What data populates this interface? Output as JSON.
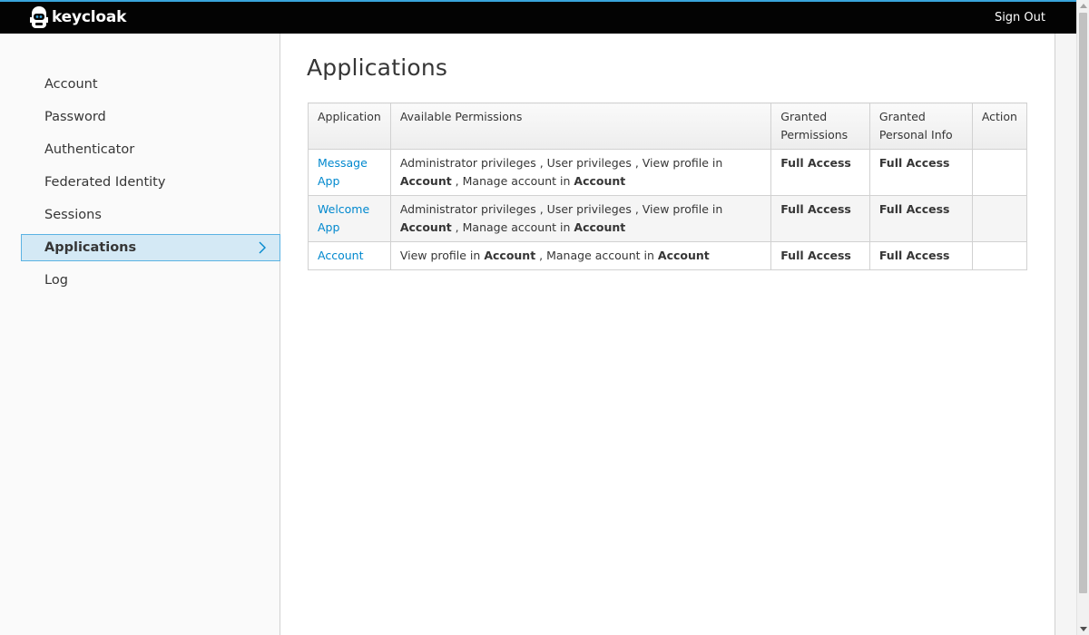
{
  "header": {
    "brand": "keycloak",
    "signout_label": "Sign Out"
  },
  "sidebar": {
    "items": [
      {
        "label": "Account",
        "active": false
      },
      {
        "label": "Password",
        "active": false
      },
      {
        "label": "Authenticator",
        "active": false
      },
      {
        "label": "Federated Identity",
        "active": false
      },
      {
        "label": "Sessions",
        "active": false
      },
      {
        "label": "Applications",
        "active": true
      },
      {
        "label": "Log",
        "active": false
      }
    ]
  },
  "main": {
    "title": "Applications",
    "table": {
      "columns": [
        "Application",
        "Available Permissions",
        "Granted Permissions",
        "Granted Personal Info",
        "Action"
      ],
      "rows": [
        {
          "application": "Message App",
          "permissions": [
            {
              "text": "Administrator privileges",
              "client": ""
            },
            {
              "text": "User privileges",
              "client": ""
            },
            {
              "text": "View profile in",
              "client": "Account"
            },
            {
              "text": "Manage account in",
              "client": "Account"
            }
          ],
          "granted_permissions": "Full Access",
          "granted_personal_info": "Full Access",
          "action": ""
        },
        {
          "application": "Welcome App",
          "permissions": [
            {
              "text": "Administrator privileges",
              "client": ""
            },
            {
              "text": "User privileges",
              "client": ""
            },
            {
              "text": "View profile in",
              "client": "Account"
            },
            {
              "text": "Manage account in",
              "client": "Account"
            }
          ],
          "granted_permissions": "Full Access",
          "granted_personal_info": "Full Access",
          "action": ""
        },
        {
          "application": "Account",
          "permissions": [
            {
              "text": "View profile in",
              "client": "Account"
            },
            {
              "text": "Manage account in",
              "client": "Account"
            }
          ],
          "granted_permissions": "Full Access",
          "granted_personal_info": "Full Access",
          "action": ""
        }
      ]
    }
  },
  "colors": {
    "accent": "#39a5dc",
    "link": "#0088ce",
    "active_bg": "#d4e9f5",
    "active_border": "#5bb3e3",
    "header_bg": "#030303"
  },
  "icons": {
    "brand": "keycloak-logo-icon",
    "active_chevron": "chevron-right-icon"
  }
}
